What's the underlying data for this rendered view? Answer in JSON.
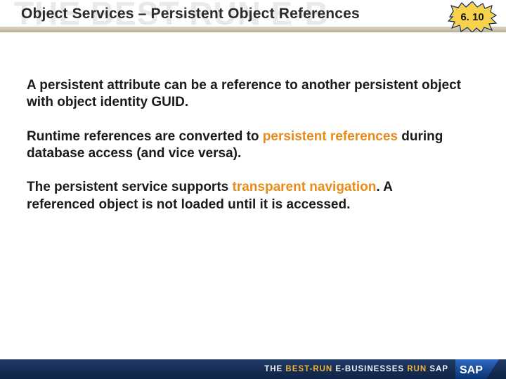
{
  "watermark": "THE BEST-RUN E-B",
  "title": "Object Services – Persistent Object References",
  "burst": {
    "label": "6. 10",
    "fill": "#f6d24d",
    "stroke": "#0e2a66"
  },
  "paragraphs": [
    {
      "pre": "A persistent attribute can be a reference to another persistent object with object identity GUID.",
      "hl": "",
      "post": ""
    },
    {
      "pre": "Runtime references are converted to ",
      "hl": "persistent references",
      "post": " during database access (and vice versa)."
    },
    {
      "pre": "The persistent service supports ",
      "hl": "transparent navigation",
      "post": ". A referenced object is not loaded until it is accessed."
    }
  ],
  "footer": {
    "pre": "THE ",
    "gold1": "BEST-RUN",
    "mid": " E-BUSINESSES ",
    "gold2": "RUN",
    "post": " SAP"
  },
  "logo": {
    "text": "SAP"
  }
}
